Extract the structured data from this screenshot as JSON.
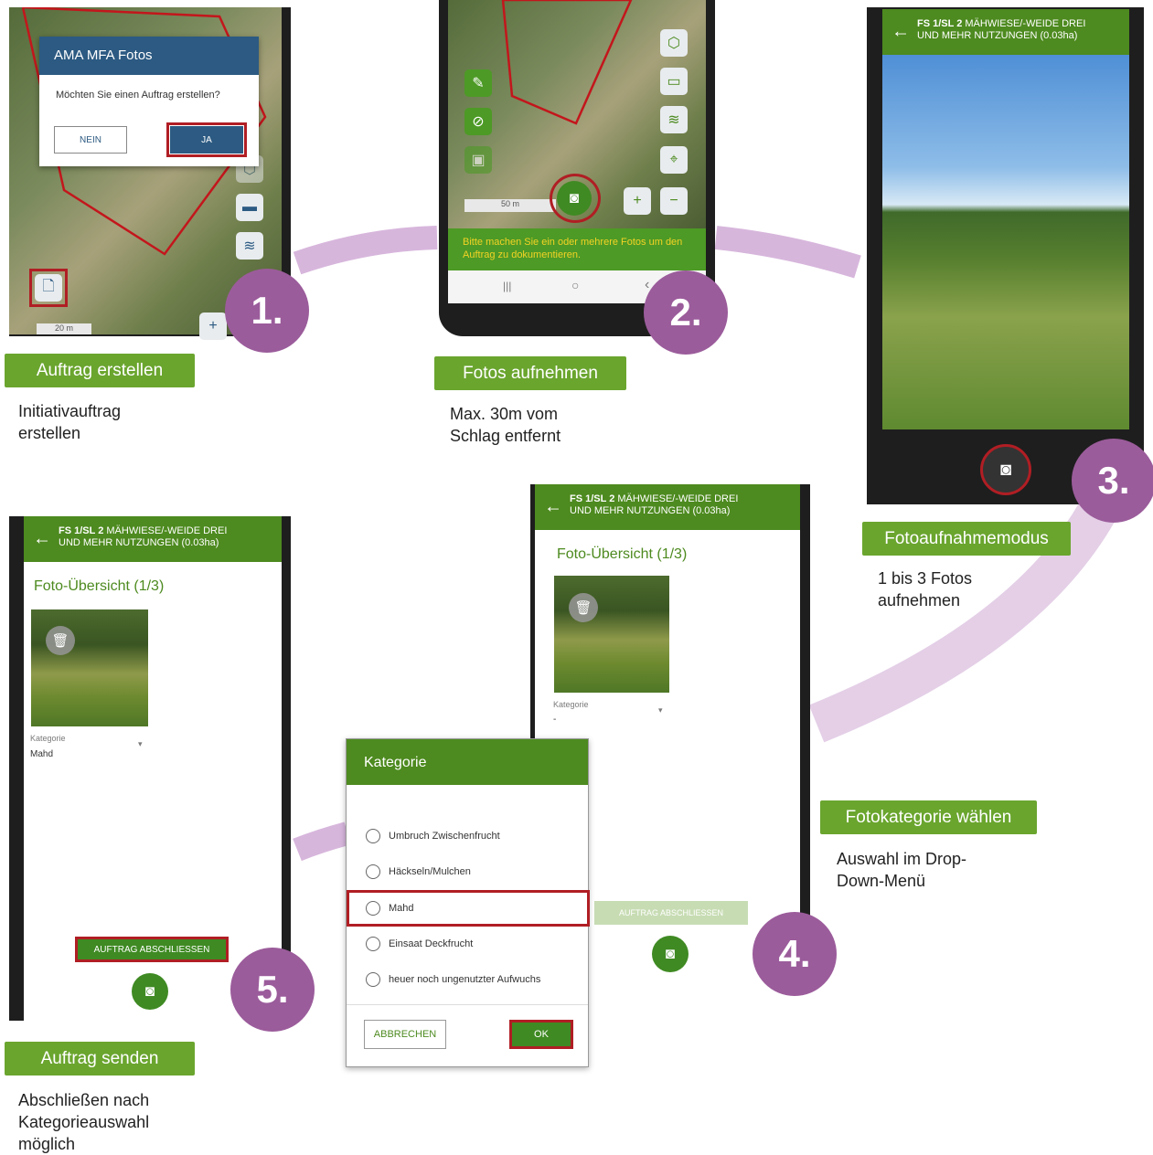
{
  "steps": [
    {
      "number": "1.",
      "label": "Auftrag erstellen",
      "description": "Initiativauftrag\nerstellen"
    },
    {
      "number": "2.",
      "label": "Fotos aufnehmen",
      "description": "Max. 30m vom\nSchlag entfernt"
    },
    {
      "number": "3.",
      "label": "Fotoaufnahmemodus",
      "description": "1 bis 3 Fotos\naufnehmen"
    },
    {
      "number": "4.",
      "label": "Fotokategorie wählen",
      "description": "Auswahl im Drop-\nDown-Menü"
    },
    {
      "number": "5.",
      "label": "Auftrag senden",
      "description": "Abschließen nach\nKategorieauswahl\nmöglich"
    }
  ],
  "screen1": {
    "dialog_title": "AMA MFA Fotos",
    "dialog_question": "Möchten Sie einen Auftrag erstellen?",
    "no_button": "NEIN",
    "yes_button": "JA",
    "scale_label": "20 m",
    "zoom_in": "+"
  },
  "screen2": {
    "scale_label": "50 m",
    "hint": "Bitte machen Sie ein oder mehrere Fotos um den Auftrag zu dokumentieren.",
    "zoom_in": "+",
    "zoom_out": "−",
    "nav_recent": "|||",
    "nav_home": "○",
    "nav_back": "‹"
  },
  "app_header": {
    "title_line1_bold": "FS 1/SL 2",
    "title_line1_rest": " MÄHWIESE/-WEIDE DREI",
    "title_line2": "UND MEHR NUTZUNGEN (0.03ha)"
  },
  "screen4": {
    "overview_title": "Foto-Übersicht (1/3)",
    "category_label": "Kategorie",
    "category_value": "-",
    "finish_button": "AUFTRAG ABSCHLIESSEN"
  },
  "category_dialog": {
    "title": "Kategorie",
    "options": [
      "Umbruch Zwischenfrucht",
      "Häckseln/Mulchen",
      "Mahd",
      "Einsaat Deckfrucht",
      "heuer noch ungenutzter Aufwuchs"
    ],
    "selected": "Mahd",
    "cancel_button": "ABBRECHEN",
    "ok_button": "OK"
  },
  "screen5": {
    "overview_title": "Foto-Übersicht (1/3)",
    "category_label": "Kategorie",
    "category_value": "Mahd",
    "finish_button": "AUFTRAG ABSCHLIESSEN"
  },
  "colors": {
    "label_green": "#6aa52e",
    "app_green": "#4d8a1f",
    "step_purple": "#9b5c9b",
    "highlight_red": "#b01e24",
    "connector_lilac": "#d7b6dc"
  },
  "icons": [
    "document-icon",
    "camera-icon",
    "edit-icon",
    "cancel-icon",
    "image-icon",
    "layers-icon",
    "cube-icon",
    "crosshair-icon",
    "trash-icon",
    "back-arrow-icon",
    "chevron-down-icon"
  ]
}
